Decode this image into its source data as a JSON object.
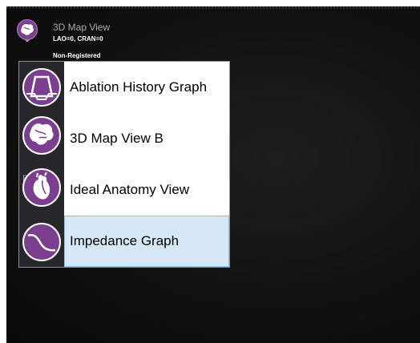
{
  "header": {
    "title": "3D Map View",
    "angles": "LAO=0, CRAN=0",
    "registration": "Non-Registered",
    "icon": "heart-map-icon"
  },
  "menu": {
    "items": [
      {
        "label": "Ablation History Graph",
        "icon": "ablation-history-icon",
        "tag": ""
      },
      {
        "label": "3D Map View B",
        "icon": "heart-map-icon",
        "tag": "B"
      },
      {
        "label": "Ideal Anatomy View",
        "icon": "heart-anatomy-icon",
        "tag": ""
      },
      {
        "label": "Impedance Graph",
        "icon": "impedance-curve-icon",
        "tag": ""
      }
    ],
    "selected_index": 3
  },
  "colors": {
    "icon_purple": "#7b3f8f",
    "selection_bg": "#d6e8f8",
    "strip_bg": "#26262b"
  }
}
